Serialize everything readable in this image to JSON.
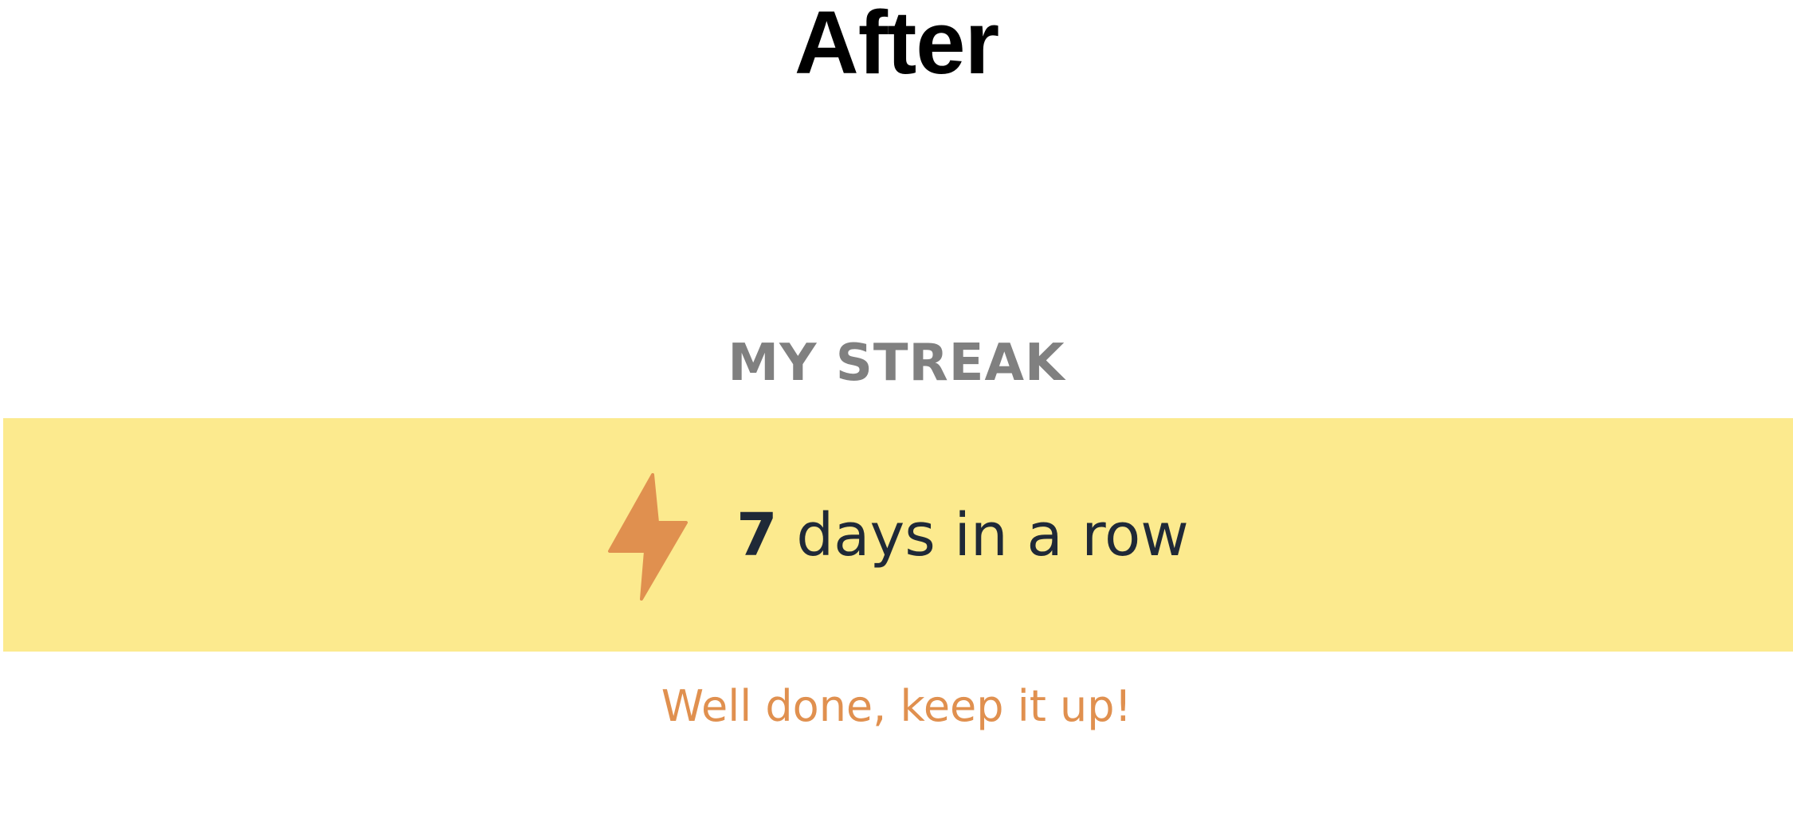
{
  "heading": "After",
  "streak": {
    "label": "MY STREAK",
    "count": "7",
    "unit_text": "days in a row",
    "message": "Well done, keep it up!",
    "icon": "lightning-bolt-icon"
  },
  "colors": {
    "banner_background": "#fcea8e",
    "accent": "#e0904f",
    "label_gray": "#808080",
    "text_dark": "#1f2937"
  }
}
